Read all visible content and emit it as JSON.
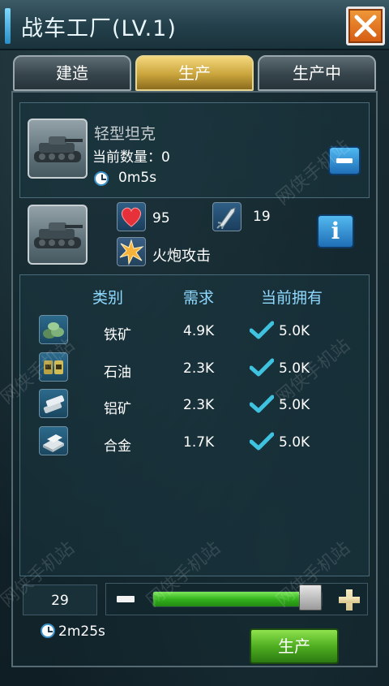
{
  "header": {
    "title": "战车工厂(LV.1)"
  },
  "tabs": [
    {
      "label": "建造"
    },
    {
      "label": "生产"
    },
    {
      "label": "生产中"
    }
  ],
  "unit": {
    "name": "轻型坦克",
    "count_label": "当前数量：0",
    "build_time": "0m5s"
  },
  "stats": {
    "hp": "95",
    "attack": "19",
    "attack_type": "火炮攻击"
  },
  "requirements": {
    "headers": [
      "类别",
      "需求",
      "当前拥有"
    ],
    "rows": [
      {
        "name": "铁矿",
        "required": "4.9K",
        "owned": "5.0K",
        "icon": "iron-ore-icon"
      },
      {
        "name": "石油",
        "required": "2.3K",
        "owned": "5.0K",
        "icon": "oil-icon"
      },
      {
        "name": "铝矿",
        "required": "2.3K",
        "owned": "5.0K",
        "icon": "aluminum-ore-icon"
      },
      {
        "name": "合金",
        "required": "1.7K",
        "owned": "5.0K",
        "icon": "alloy-icon"
      }
    ]
  },
  "production": {
    "quantity": "29",
    "slider_fraction": 0.93,
    "total_time": "2m25s",
    "produce_label": "生产"
  },
  "watermark": "网侠手机站",
  "colors": {
    "accent_blue": "#8fd9ff",
    "tab_active": "#c9a43c",
    "close": "#d55b12",
    "produce_green": "#4fae21",
    "check": "#3fc2e0"
  }
}
